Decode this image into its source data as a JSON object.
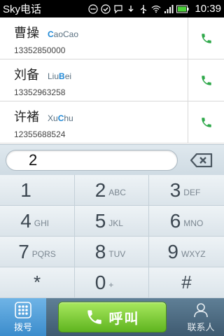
{
  "status_bar": {
    "title": "Sky电话",
    "time": "10:39",
    "icons": [
      "dots-icon",
      "check-circle-icon",
      "chat-icon",
      "download-icon",
      "usb-icon",
      "wifi-icon",
      "signal-icon",
      "battery-icon"
    ]
  },
  "contacts": [
    {
      "name": "曹操",
      "pinyin_pre": "",
      "pinyin_hl": "C",
      "pinyin_post": "aoCao",
      "number": "13352850000"
    },
    {
      "name": "刘备",
      "pinyin_pre": "Liu",
      "pinyin_hl": "B",
      "pinyin_post": "ei",
      "number": "13352963258"
    },
    {
      "name": "许褚",
      "pinyin_pre": "Xu",
      "pinyin_hl": "C",
      "pinyin_post": "hu",
      "number": "12355688524"
    }
  ],
  "input": {
    "value": "2"
  },
  "keypad": [
    {
      "digit": "1",
      "letters": ""
    },
    {
      "digit": "2",
      "letters": "ABC"
    },
    {
      "digit": "3",
      "letters": "DEF"
    },
    {
      "digit": "4",
      "letters": "GHI"
    },
    {
      "digit": "5",
      "letters": "JKL"
    },
    {
      "digit": "6",
      "letters": "MNO"
    },
    {
      "digit": "7",
      "letters": "PQRS"
    },
    {
      "digit": "8",
      "letters": "TUV"
    },
    {
      "digit": "9",
      "letters": "WXYZ"
    },
    {
      "digit": "*",
      "letters": ""
    },
    {
      "digit": "0",
      "letters": "+"
    },
    {
      "digit": "#",
      "letters": ""
    }
  ],
  "bottom": {
    "dial_label": "拨号",
    "call_label": "呼叫",
    "contacts_label": "联系人"
  },
  "colors": {
    "call_green": "#2fa84a",
    "highlight_blue": "#1e88d6",
    "call_button": "#7acb35"
  }
}
